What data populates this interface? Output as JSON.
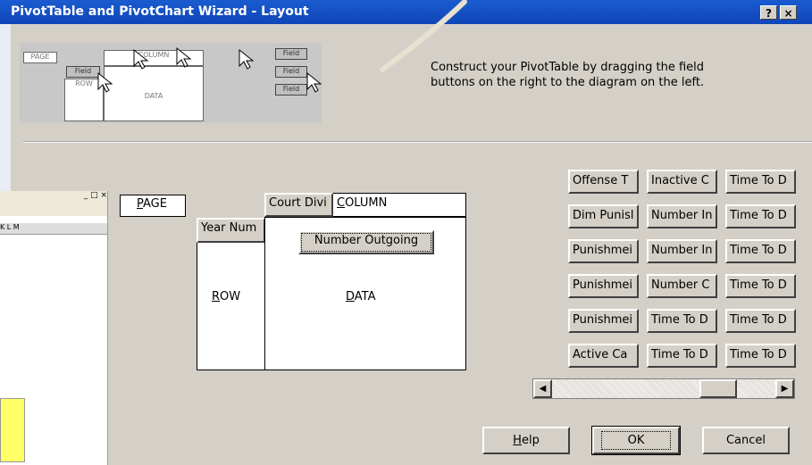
{
  "window": {
    "title": "PivotTable and PivotChart Wizard - Layout",
    "help_glyph": "?",
    "close_glyph": "×"
  },
  "illustration": {
    "page": "PAGE",
    "column": "COLUMN",
    "row": "ROW",
    "data": "DATA",
    "field_a": "Field",
    "field_b": "Field",
    "field_c": "Field",
    "field_d": "Field",
    "field_e": "Field"
  },
  "instructions": "Construct your PivotTable by dragging the field buttons on the right to the diagram on the left.",
  "layout": {
    "page_label": "PAGE",
    "page_accesskey": "P",
    "page_rest": "AGE",
    "column_field": "Court Divi",
    "column_label_first": "C",
    "column_label_rest": "OLUMN",
    "row_field": "Year Num",
    "row_label_first": "R",
    "row_label_rest": "OW",
    "data_field": "Number Outgoing",
    "data_label_first": "D",
    "data_label_rest": "ATA"
  },
  "fields": [
    "Offense T",
    "Inactive C",
    "Time To D",
    "Dim Punisl",
    "Number In",
    "Time To D",
    "Punishmei",
    "Number In",
    "Time To D",
    "Punishmei",
    "Number C",
    "Time To D",
    "Punishmei",
    "Time To D",
    "Time To D",
    "Active Ca",
    "Time To D",
    "Time To D"
  ],
  "scrollbar": {
    "left_arrow": "◀",
    "right_arrow": "▶"
  },
  "buttons": {
    "help_first": "H",
    "help_rest": "elp",
    "ok": "OK",
    "cancel": "Cancel"
  },
  "background_excel": {
    "controls": "_ □ ×",
    "columns": "K      L      M"
  }
}
